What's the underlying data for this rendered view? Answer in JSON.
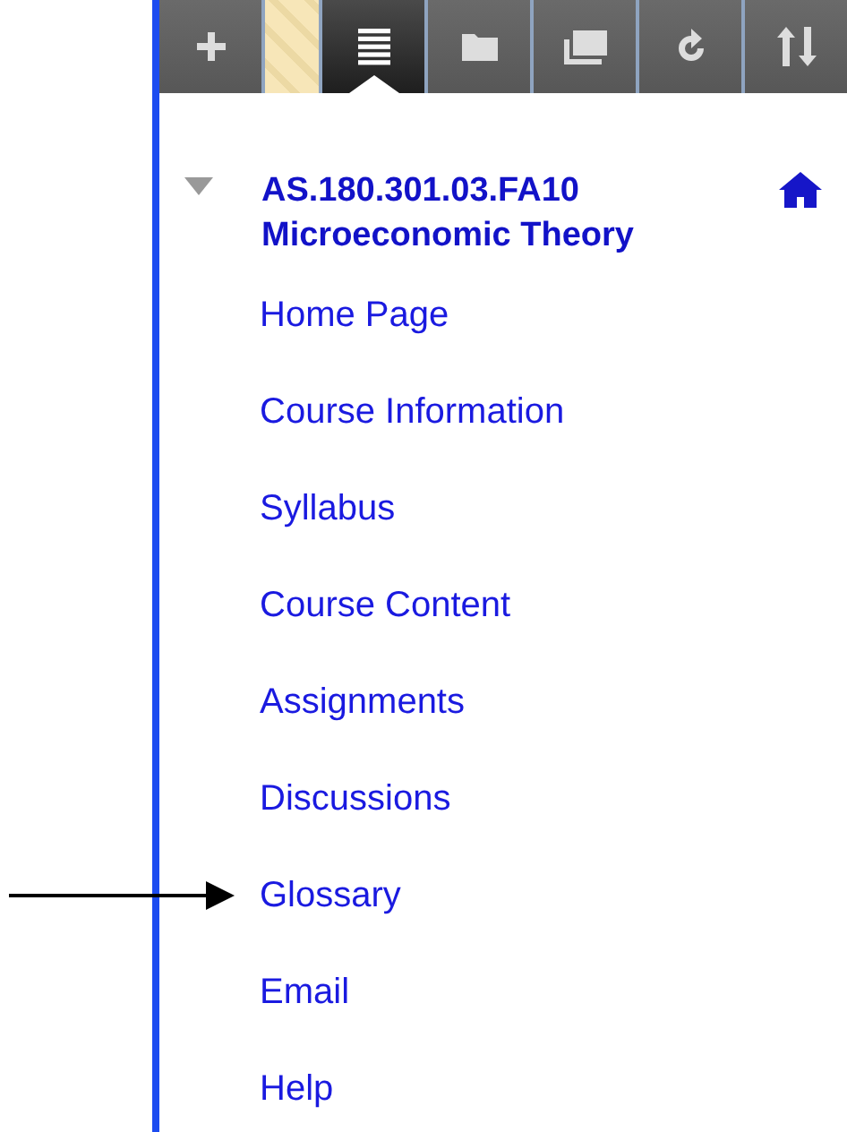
{
  "toolbar": [
    {
      "kind": "add",
      "selected": false
    },
    {
      "kind": "stripe"
    },
    {
      "kind": "list",
      "selected": true
    },
    {
      "kind": "folder",
      "selected": false
    },
    {
      "kind": "windows",
      "selected": false
    },
    {
      "kind": "refresh",
      "selected": false
    },
    {
      "kind": "sort",
      "selected": false
    }
  ],
  "course": {
    "expanded": true,
    "code": "AS.180.301.03.FA10",
    "name": "Microeconomic Theory"
  },
  "menu": [
    {
      "label": "Home Page"
    },
    {
      "label": "Course Information"
    },
    {
      "label": "Syllabus"
    },
    {
      "label": "Course Content"
    },
    {
      "label": "Assignments"
    },
    {
      "label": "Discussions"
    },
    {
      "label": "Glossary",
      "pointed": true
    },
    {
      "label": "Email"
    },
    {
      "label": "Help"
    }
  ]
}
